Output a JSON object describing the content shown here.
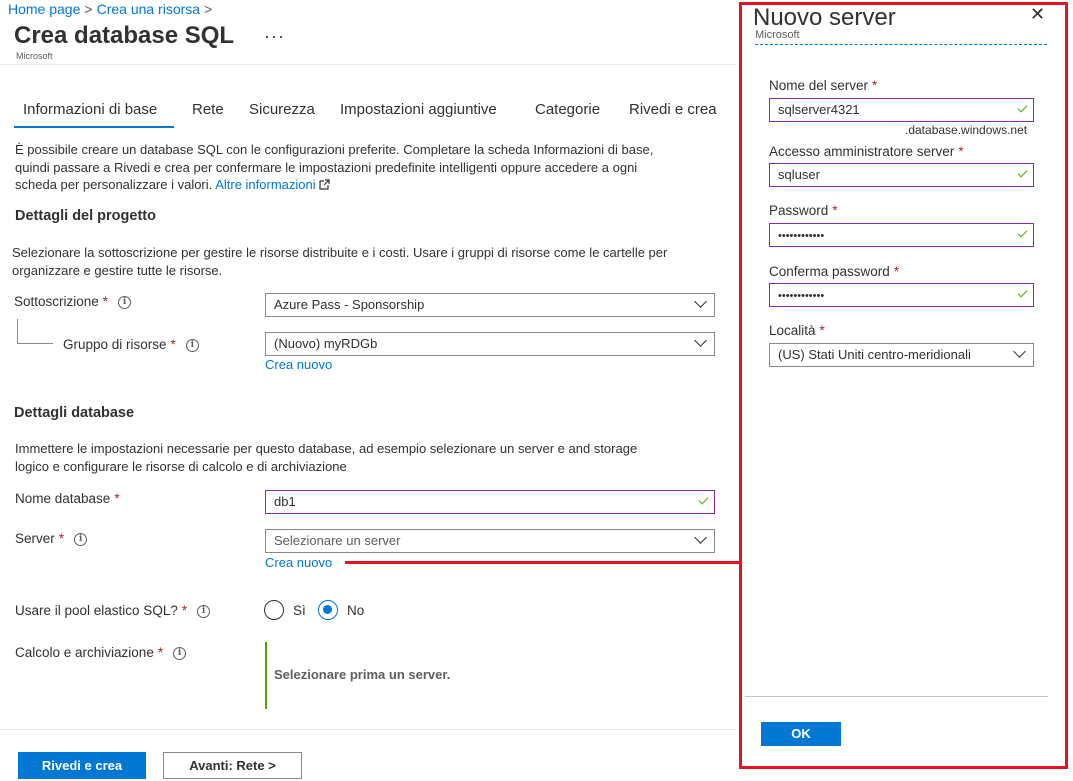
{
  "breadcrumb": {
    "home": "Home page",
    "sep": ">",
    "create": "Crea una risorsa",
    "trail_sep": ">"
  },
  "page": {
    "title": "Crea database SQL",
    "more": "···",
    "subtitle": "Microsoft"
  },
  "tabs": [
    "Informazioni di base",
    "Rete",
    "Sicurezza",
    "Impostazioni aggiuntive",
    "Categorie",
    "Rivedi e crea"
  ],
  "intro": {
    "line1": "È possibile creare un database SQL con le configurazioni preferite. Completare la scheda Informazioni di base,",
    "line2": "quindi  passare a Rivedi e crea per confermare le impostazioni predefinite intelligenti oppure accedere a ogni",
    "line3": "scheda per personalizzare i valori.",
    "link": "Altre informazioni",
    "link_icon": "external-link-icon"
  },
  "project": {
    "title": "Dettagli del progetto",
    "desc1": "Selezionare la sottoscrizione per gestire le risorse distribuite e i costi. Usare i gruppi di risorse come le cartelle per",
    "desc2": "organizzare e gestire tutte le risorse.",
    "subscription_label": "Sottoscrizione",
    "subscription_value": "Azure Pass - Sponsorship",
    "rg_label": "Gruppo di risorse",
    "rg_value": "(Nuovo) myRDGb",
    "rg_create": "Crea nuovo"
  },
  "database": {
    "title": "Dettagli database",
    "desc1": "Immettere le impostazioni necessarie per questo database, ad esempio selezionare un server e and storage",
    "desc2": "logico e configurare le risorse di calcolo e di archiviazione",
    "name_label": "Nome database",
    "name_value": "db1",
    "server_label": "Server",
    "server_placeholder": "Selezionare un server",
    "server_create": "Crea nuovo",
    "pool_label": "Usare il pool elastico SQL?",
    "pool_yes": "Sì",
    "pool_no": "No",
    "pool_selected": "No",
    "compute_label": "Calcolo e archiviazione",
    "compute_msg": "Selezionare prima un server."
  },
  "required_mark": "*",
  "info_glyph": "i",
  "footer": {
    "review": "Rivedi e crea",
    "next": "Avanti: Rete >"
  },
  "panel": {
    "title": "Nuovo server",
    "subtitle": "Microsoft",
    "close": "✕",
    "server_name_label": "Nome del server",
    "server_name_value": "sqlserver4321",
    "server_suffix": ".database.windows.net",
    "admin_label": "Accesso amministratore server",
    "admin_value": "sqluser",
    "password_label": "Password",
    "password_value": "••••••••••••",
    "confirm_label": "Conferma password",
    "confirm_value": "••••••••••••",
    "location_label": "Località",
    "location_value": "(US) Stati Uniti centro-meridionali",
    "ok": "OK"
  },
  "colors": {
    "accent": "#0078d4",
    "highlight": "#e81123",
    "valid": "#57a300",
    "focus_border": "#8a2aa8"
  }
}
